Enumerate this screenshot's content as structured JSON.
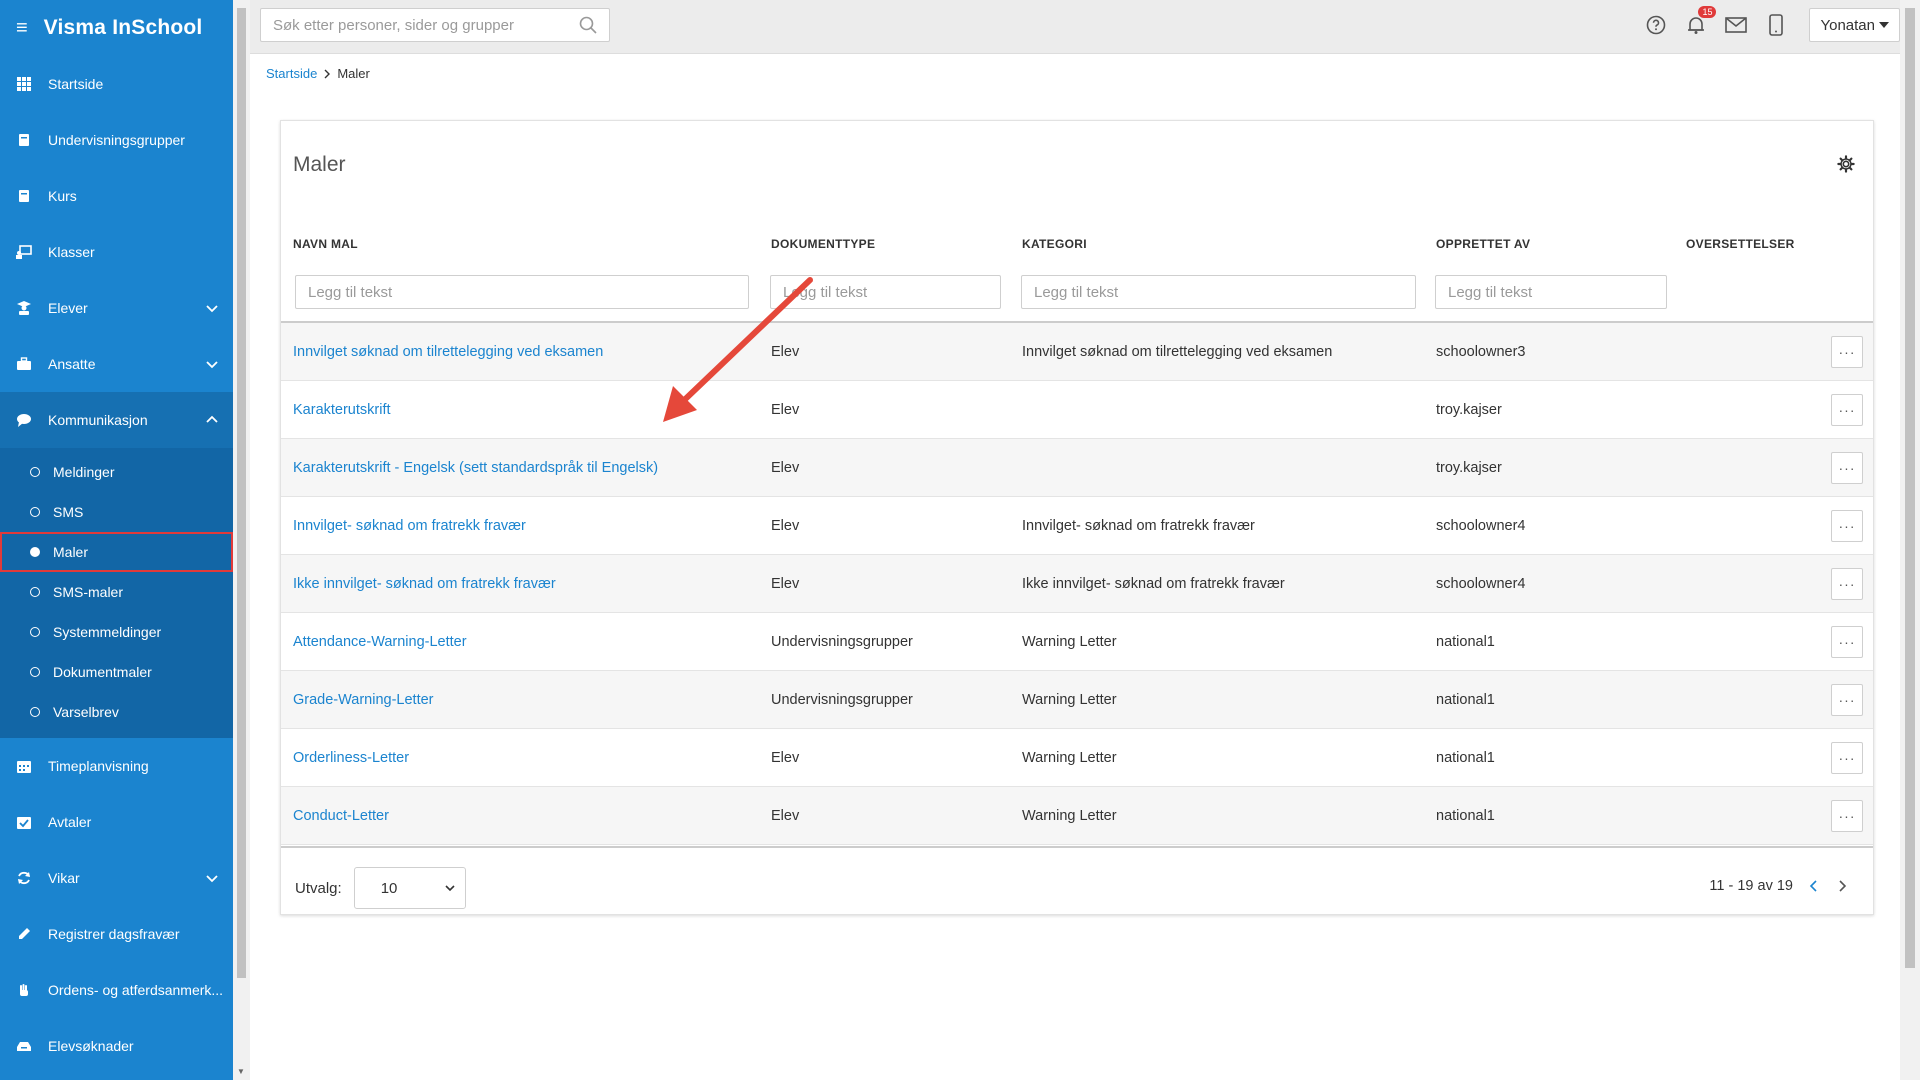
{
  "app": {
    "name": "Visma InSchool"
  },
  "search": {
    "placeholder": "Søk etter personer, sider og grupper"
  },
  "notifications": {
    "count": "15"
  },
  "user": {
    "name": "Yonatan"
  },
  "sidebar": {
    "items": [
      {
        "label": "Startside",
        "icon": "grid-icon"
      },
      {
        "label": "Undervisningsgrupper",
        "icon": "book-icon"
      },
      {
        "label": "Kurs",
        "icon": "book-icon"
      },
      {
        "label": "Klasser",
        "icon": "presentation-icon"
      },
      {
        "label": "Elever",
        "icon": "student-icon"
      },
      {
        "label": "Ansatte",
        "icon": "briefcase-icon"
      },
      {
        "label": "Kommunikasjon",
        "icon": "chat-icon"
      }
    ],
    "sub_items": [
      {
        "label": "Meldinger"
      },
      {
        "label": "SMS"
      },
      {
        "label": "Maler"
      },
      {
        "label": "SMS-maler"
      },
      {
        "label": "Systemmeldinger"
      },
      {
        "label": "Dokumentmaler"
      },
      {
        "label": "Varselbrev"
      }
    ],
    "bottom_items": [
      {
        "label": "Timeplanvisning",
        "icon": "calendar-icon"
      },
      {
        "label": "Avtaler",
        "icon": "calendar-check-icon"
      },
      {
        "label": "Vikar",
        "icon": "refresh-icon"
      },
      {
        "label": "Registrer dagsfravær",
        "icon": "pencil-icon"
      },
      {
        "label": "Ordens- og atferdsanmerk...",
        "icon": "hand-icon"
      },
      {
        "label": "Elevsøknader",
        "icon": "inbox-icon"
      }
    ],
    "colors": {
      "bg": "#1b84cf",
      "active_outline": "#e03a3a"
    }
  },
  "breadcrumb": {
    "home": "Startside",
    "current": "Maler"
  },
  "card": {
    "title": "Maler",
    "columns": {
      "name": "NAVN MAL",
      "doctype": "DOKUMENTTYPE",
      "category": "KATEGORI",
      "created_by": "OPPRETTET AV",
      "translations": "OVERSETTELSER"
    },
    "filter_placeholder": "Legg til tekst",
    "rows": [
      {
        "name": "Innvilget søknad om tilrettelegging ved eksamen",
        "doctype": "Elev",
        "category": "Innvilget søknad om tilrettelegging ved eksamen",
        "created_by": "schoolowner3",
        "more": "···"
      },
      {
        "name": "Karakterutskrift",
        "doctype": "Elev",
        "category": "",
        "created_by": "troy.kajser",
        "more": "···"
      },
      {
        "name": "Karakterutskrift - Engelsk (sett standardspråk til Engelsk)",
        "doctype": "Elev",
        "category": "",
        "created_by": "troy.kajser",
        "more": "···"
      },
      {
        "name": "Innvilget- søknad om fratrekk fravær",
        "doctype": "Elev",
        "category": "Innvilget- søknad om fratrekk fravær",
        "created_by": "schoolowner4",
        "more": "···"
      },
      {
        "name": "Ikke innvilget- søknad om fratrekk fravær",
        "doctype": "Elev",
        "category": "Ikke innvilget- søknad om fratrekk fravær",
        "created_by": "schoolowner4",
        "more": "···"
      },
      {
        "name": "Attendance-Warning-Letter",
        "doctype": "Undervisningsgrupper",
        "category": "Warning Letter",
        "created_by": "national1",
        "more": "···"
      },
      {
        "name": "Grade-Warning-Letter",
        "doctype": "Undervisningsgrupper",
        "category": "Warning Letter",
        "created_by": "national1",
        "more": "···"
      },
      {
        "name": "Orderliness-Letter",
        "doctype": "Elev",
        "category": "Warning Letter",
        "created_by": "national1",
        "more": "···"
      },
      {
        "name": "Conduct-Letter",
        "doctype": "Elev",
        "category": "Warning Letter",
        "created_by": "national1",
        "more": "···"
      }
    ],
    "page_size_label": "Utvalg:",
    "page_size": "10",
    "pagination": "11 - 19 av 19"
  },
  "colors": {
    "link": "#1b84cf",
    "annotation": "#e5483a"
  }
}
